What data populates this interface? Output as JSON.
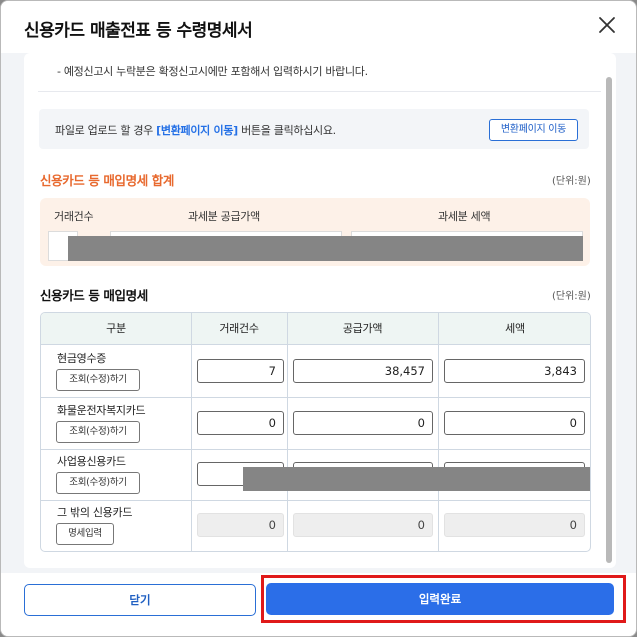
{
  "modal": {
    "title": "신용카드 매출전표 등 수령명세서"
  },
  "notice": {
    "top_text": "- 예정신고시 누락분은 확정신고시에만 포함해서 입력하시기 바랍니다."
  },
  "upload": {
    "text_before": "파일로 업로드 할 경우 ",
    "text_highlight": "[변환페이지 이동]",
    "text_after": " 버튼을 클릭하십시요.",
    "button_label": "변환페이지 이동"
  },
  "summary": {
    "title": "신용카드 등 매입명세 합계",
    "unit": "(단위:원)",
    "headers": [
      "거래건수",
      "과세분 공급가액",
      "과세분 세액"
    ]
  },
  "detail": {
    "title": "신용카드 등 매입명세",
    "unit": "(단위:원)",
    "headers": [
      "구분",
      "거래건수",
      "공급가액",
      "세액"
    ],
    "rows": [
      {
        "label": "현금영수증",
        "button": "조회(수정)하기",
        "count": "7",
        "supply": "38,457",
        "tax": "3,843"
      },
      {
        "label": "화물운전자복지카드",
        "button": "조회(수정)하기",
        "count": "0",
        "supply": "0",
        "tax": "0"
      },
      {
        "label": "사업용신용카드",
        "button": "조회(수정)하기",
        "count": "",
        "supply": "",
        "tax": ""
      },
      {
        "label": "그 밖의 신용카드",
        "button": "명세입력",
        "count": "0",
        "supply": "0",
        "tax": "0"
      }
    ]
  },
  "footer": {
    "close_label": "닫기",
    "submit_label": "입력완료"
  },
  "colors": {
    "accent": "#2b6ee8",
    "summary_title": "#e8692e",
    "highlight_frame": "#e01919"
  }
}
